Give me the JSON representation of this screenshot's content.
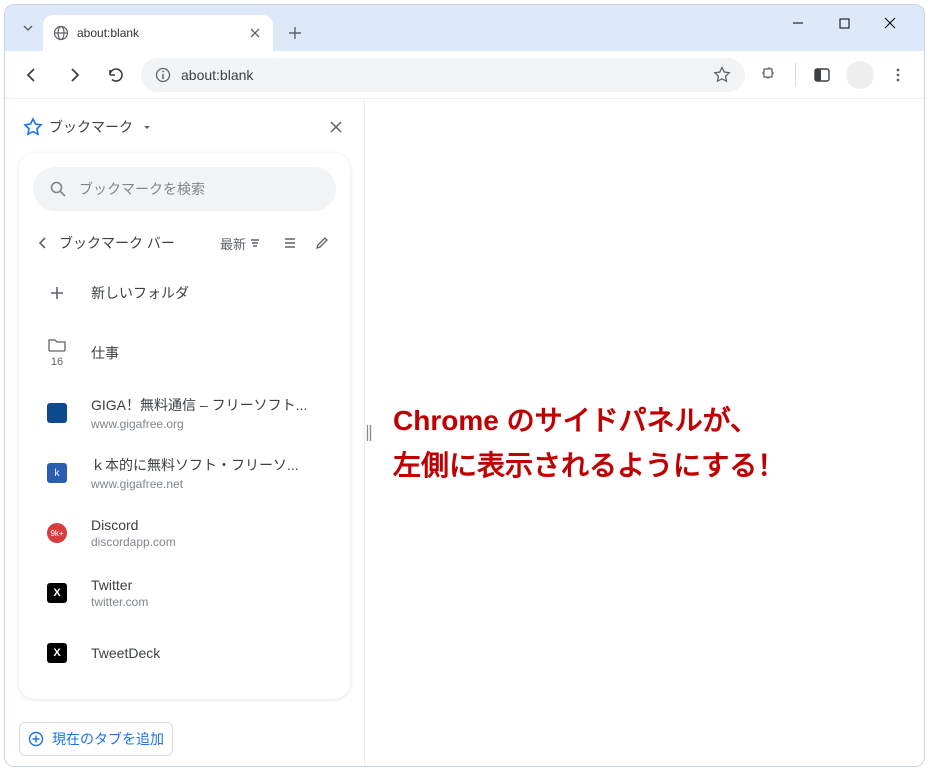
{
  "tab": {
    "title": "about:blank"
  },
  "urlbar": {
    "text": "about:blank"
  },
  "panel": {
    "title": "ブックマーク",
    "search_placeholder": "ブックマークを検索",
    "breadcrumb": "ブックマーク バー",
    "sort_label": "最新",
    "new_folder_label": "新しいフォルダ",
    "add_current_tab": "現在のタブを追加"
  },
  "folder": {
    "name": "仕事",
    "count": "16"
  },
  "bookmarks": [
    {
      "title": "GIGA！無料通信 – フリーソフト...",
      "url": "www.gigafree.org",
      "favicon": "giga"
    },
    {
      "title": "ｋ本的に無料ソフト・フリーソ...",
      "url": "www.gigafree.net",
      "favicon": "k"
    },
    {
      "title": "Discord",
      "url": "discordapp.com",
      "favicon": "discord"
    },
    {
      "title": "Twitter",
      "url": "twitter.com",
      "favicon": "x"
    },
    {
      "title": "TweetDeck",
      "url": "",
      "favicon": "x"
    }
  ],
  "annotation": {
    "line1": "Chrome のサイドパネルが、",
    "line2": "左側に表示されるようにする！"
  }
}
